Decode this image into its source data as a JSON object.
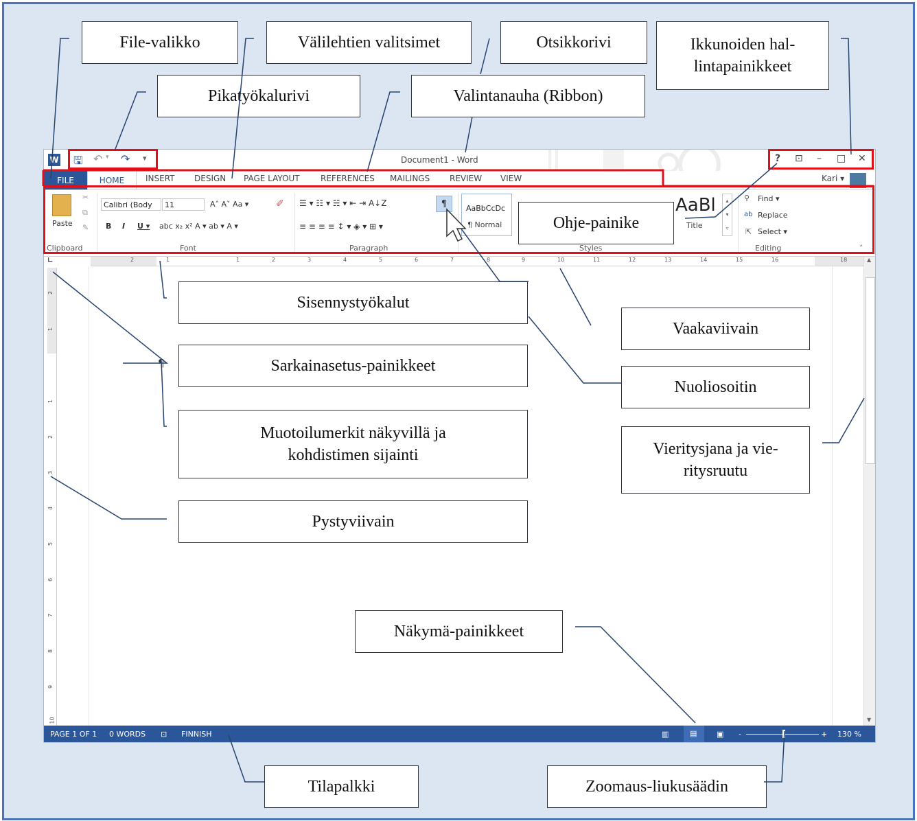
{
  "callouts": {
    "file_menu": "File-valikko",
    "tab_selectors": "Välilehtien valitsimet",
    "title_bar": "Otsikkorivi",
    "window_controls": "Ikkunoiden hal-\nlintapainikkeet",
    "quick_access": "Pikatyökalurivi",
    "ribbon": "Valintanauha (Ribbon)",
    "help_button": "Ohje-painike",
    "indent_tools": "Sisennystyökalut",
    "horizontal_ruler": "Vaakaviivain",
    "tab_buttons": "Sarkainasetus-painikkeet",
    "mouse_pointer": "Nuoliosoitin",
    "formatting_marks": "Muotoilumerkit näkyvillä ja\nkohdistimen sijainti",
    "scrollbar": "Vieritysjana ja vie-\nritysruutu",
    "vertical_ruler": "Pystyviivain",
    "view_buttons": "Näkymä-painikkeet",
    "status_bar": "Tilapalkki",
    "zoom_slider": "Zoomaus-liukusäädin"
  },
  "word": {
    "logo": "W",
    "title": "Document1 - Word",
    "qat": {
      "save": "🖫",
      "undo": "↶",
      "undo_drop": "▾",
      "redo": "↷",
      "more": "▾"
    },
    "window_buttons": {
      "help": "?",
      "ribbon_display": "⊡",
      "minimize": "–",
      "maximize": "□",
      "close": "✕"
    },
    "user": "Kari ▾",
    "tabs": [
      "FILE",
      "HOME",
      "INSERT",
      "DESIGN",
      "PAGE LAYOUT",
      "REFERENCES",
      "MAILINGS",
      "REVIEW",
      "VIEW"
    ],
    "ribbon": {
      "clipboard": {
        "paste": "Paste",
        "label": "Clipboard"
      },
      "font": {
        "name": "Calibri (Body",
        "size": "11",
        "label": "Font",
        "row1": "A˄ A˅  Aa ▾",
        "row2_b": "B",
        "row2_i": "I",
        "row2_u": "U ▾",
        "row2_rest": "abc  x₂  x²   A ▾  ab ▾  A ▾"
      },
      "paragraph": {
        "label": "Paragraph",
        "row1": "☰ ▾ ☷ ▾ ☵ ▾   ⇤ ⇥   A↓Z",
        "pilcrow": "¶",
        "row2": "≡ ≡ ≡ ≡   ↕ ▾   ◈ ▾ ⊞ ▾"
      },
      "styles": {
        "label": "Styles",
        "normal_preview": "AaBbCcDc",
        "normal_name": "¶ Normal",
        "title_preview": "AaBl",
        "title_name": "Title"
      },
      "editing": {
        "label": "Editing",
        "find": "Find ▾",
        "replace": "Replace",
        "select": "Select ▾"
      }
    },
    "ruler_h_numbers": [
      "2",
      "1",
      "1",
      "2",
      "3",
      "4",
      "5",
      "6",
      "7",
      "8",
      "9",
      "10",
      "11",
      "12",
      "13",
      "14",
      "15",
      "16",
      "18"
    ],
    "ruler_v_numbers": [
      "2",
      "1",
      "1",
      "2",
      "3",
      "4",
      "5",
      "6",
      "7",
      "8",
      "9",
      "10"
    ],
    "pilcrow_mark": "¶",
    "status": {
      "page": "PAGE 1 OF 1",
      "words": "0 WORDS",
      "language": "FINNISH",
      "zoom": "130 %",
      "zoom_minus": "-",
      "zoom_plus": "+"
    }
  }
}
